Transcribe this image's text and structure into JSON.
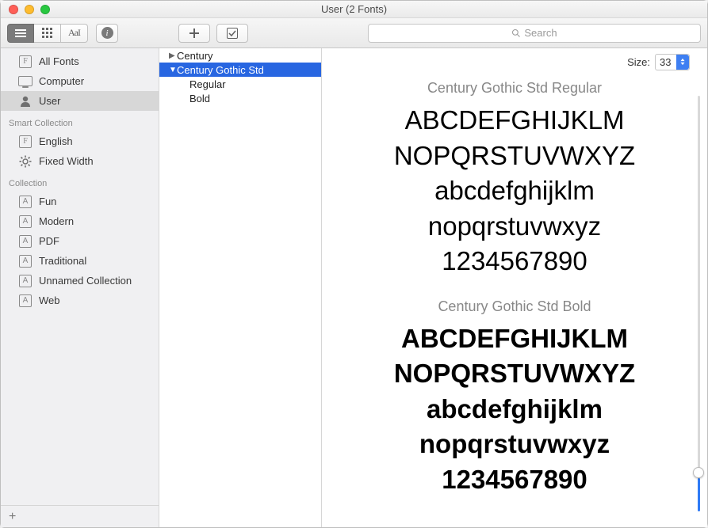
{
  "window": {
    "title": "User (2 Fonts)"
  },
  "toolbar": {
    "search_placeholder": "Search"
  },
  "sidebar": {
    "library_items": [
      {
        "label": "All Fonts",
        "icon": "F"
      },
      {
        "label": "Computer",
        "icon": "monitor"
      },
      {
        "label": "User",
        "icon": "user",
        "selected": true
      }
    ],
    "smart_heading": "Smart Collection",
    "smart_items": [
      {
        "label": "English",
        "icon": "F"
      },
      {
        "label": "Fixed Width",
        "icon": "gear"
      }
    ],
    "collection_heading": "Collection",
    "collection_items": [
      {
        "label": "Fun"
      },
      {
        "label": "Modern"
      },
      {
        "label": "PDF"
      },
      {
        "label": "Traditional"
      },
      {
        "label": "Unnamed Collection"
      },
      {
        "label": "Web"
      }
    ]
  },
  "fontlist": {
    "families": [
      {
        "name": "Century",
        "expanded": false,
        "selected": false
      },
      {
        "name": "Century Gothic Std",
        "expanded": true,
        "selected": true,
        "styles": [
          "Regular",
          "Bold"
        ]
      }
    ]
  },
  "preview": {
    "size_label": "Size:",
    "size_value": "33",
    "samples": [
      {
        "title": "Century Gothic Std Regular",
        "weight": "regular",
        "lines": [
          "ABCDEFGHIJKLM",
          "NOPQRSTUVWXYZ",
          "abcdefghijklm",
          "nopqrstuvwxyz",
          "1234567890"
        ]
      },
      {
        "title": "Century Gothic Std Bold",
        "weight": "bold",
        "lines": [
          "ABCDEFGHIJKLM",
          "NOPQRSTUVWXYZ",
          "abcdefghijklm",
          "nopqrstuvwxyz",
          "1234567890"
        ]
      }
    ]
  }
}
